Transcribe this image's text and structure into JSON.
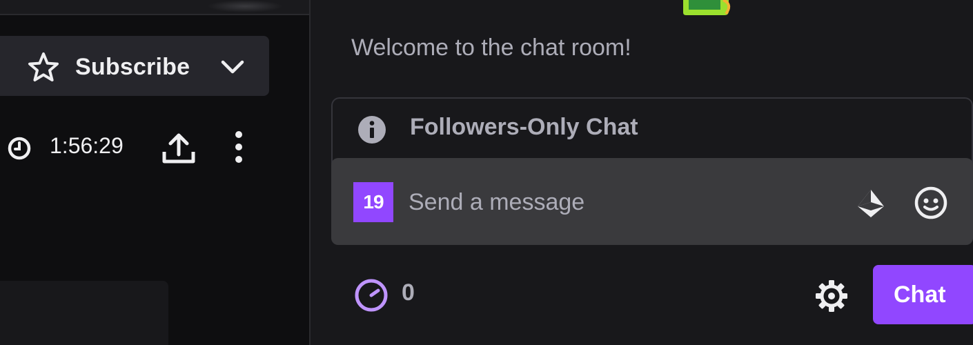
{
  "video": {
    "subscribe_label": "Subscribe",
    "uptime": "1:56:29",
    "icons": {
      "star": "star-icon",
      "chevron": "chevron-down-icon",
      "clock": "clock-icon",
      "share": "share-icon",
      "more": "more-vertical-icon"
    }
  },
  "chat": {
    "welcome_message": "Welcome to the chat room!",
    "followers_only_label": "Followers-Only Chat",
    "badge_label": "19",
    "input_placeholder": "Send a message",
    "points_count": "0",
    "chat_button_label": "Chat",
    "icons": {
      "info": "info-icon",
      "bits": "bits-icon",
      "emote": "emote-icon",
      "points": "channel-points-icon",
      "settings": "gear-icon"
    }
  },
  "colors": {
    "accent": "#9147ff",
    "background": "#0e0e10",
    "chat_panel": "#18181b",
    "input_bg": "#3a3a3d",
    "text_primary": "#efeff1",
    "text_muted": "#adadb8"
  }
}
